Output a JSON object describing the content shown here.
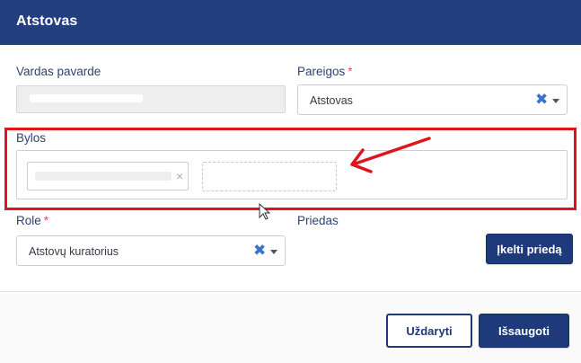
{
  "dialog": {
    "title": "Atstovas"
  },
  "form": {
    "vardas": {
      "label": "Vardas pavarde"
    },
    "pareigos": {
      "label": "Pareigos",
      "required_mark": "*",
      "value": "Atstovas",
      "clear_glyph": "✖"
    },
    "bylos": {
      "label": "Bylos",
      "tag_remove_glyph": "×"
    },
    "role": {
      "label": "Role",
      "required_mark": "*",
      "value": "Atstovų kuratorius",
      "clear_glyph": "✖"
    },
    "priedas": {
      "label": "Priedas",
      "attach_button": "Įkelti priedą"
    }
  },
  "footer": {
    "close_button": "Uždaryti",
    "save_button": "Išsaugoti"
  },
  "colors": {
    "header": "#243f7f",
    "primary": "#1e3a7a",
    "clear_icon": "#3a73c9",
    "annotation": "#e0141c",
    "required": "#d9534f"
  },
  "icons": {
    "clear": "clear-x-icon",
    "caret": "caret-down-icon",
    "tag_remove": "close-icon",
    "annotation_arrow": "arrow-left-icon",
    "cursor": "mouse-pointer-icon"
  }
}
